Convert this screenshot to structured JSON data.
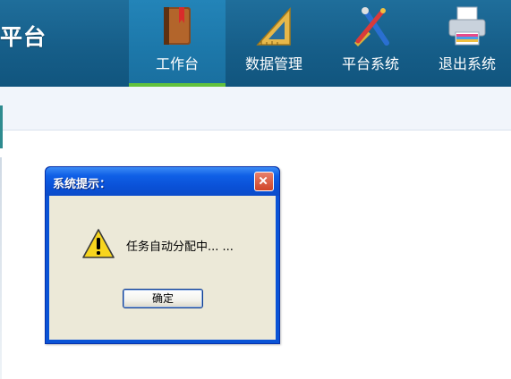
{
  "header": {
    "logo_partial": "平台",
    "nav": [
      {
        "label": "工作台",
        "icon": "book-icon",
        "active": true
      },
      {
        "label": "数据管理",
        "icon": "set-square-icon",
        "active": false
      },
      {
        "label": "平台系统",
        "icon": "tools-icon",
        "active": false
      },
      {
        "label": "退出系统",
        "icon": "printer-icon",
        "active": false
      }
    ]
  },
  "dialog": {
    "title": "系统提示：",
    "message": "任务自动分配中... ...",
    "ok_label": "确定",
    "icon": "warning-icon"
  },
  "colors": {
    "header_bg": "#165e89",
    "active_tab_bg": "#1c77a9",
    "active_underline": "#62c13c",
    "dialog_frame": "#0a53d6",
    "dialog_client": "#ece9d8"
  }
}
